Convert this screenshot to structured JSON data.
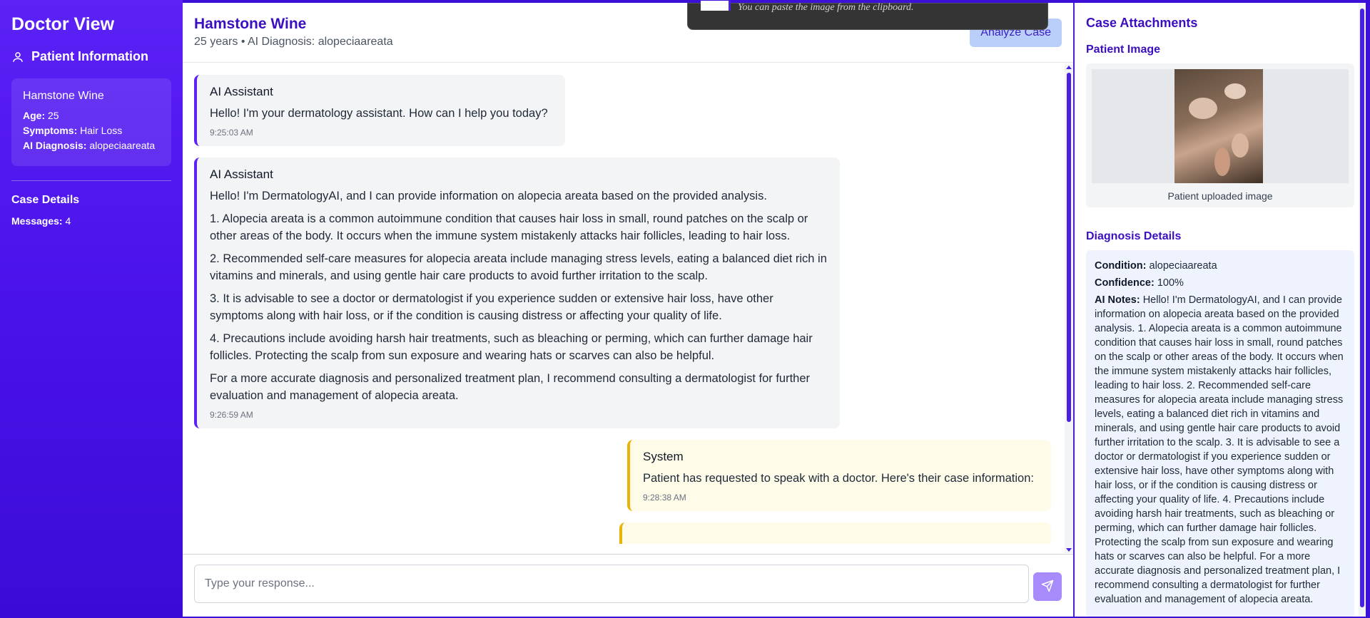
{
  "sidebar": {
    "title": "Doctor View",
    "section": "Patient Information",
    "patient": {
      "name": "Hamstone Wine",
      "age_label": "Age:",
      "age": "25",
      "symptoms_label": "Symptoms:",
      "symptoms": "Hair Loss",
      "diagnosis_label": "AI Diagnosis:",
      "diagnosis": "alopeciaareata"
    },
    "case_details": "Case Details",
    "messages_label": "Messages:",
    "messages_count": "4"
  },
  "header": {
    "name": "Hamstone Wine",
    "subtitle": "25 years • AI Diagnosis: alopeciaareata",
    "analyze_button": "Analyze Case"
  },
  "toast": {
    "text": "You can paste the image from the clipboard."
  },
  "messages": [
    {
      "sender": "AI Assistant",
      "paragraphs": [
        "Hello! I'm your dermatology assistant. How can I help you today?"
      ],
      "time": "9:25:03 AM"
    },
    {
      "sender": "AI Assistant",
      "paragraphs": [
        "Hello! I'm DermatologyAI, and I can provide information on alopecia areata based on the provided analysis.",
        "1. Alopecia areata is a common autoimmune condition that causes hair loss in small, round patches on the scalp or other areas of the body. It occurs when the immune system mistakenly attacks hair follicles, leading to hair loss.",
        "2. Recommended self-care measures for alopecia areata include managing stress levels, eating a balanced diet rich in vitamins and minerals, and using gentle hair care products to avoid further irritation to the scalp.",
        "3. It is advisable to see a doctor or dermatologist if you experience sudden or extensive hair loss, have other symptoms along with hair loss, or if the condition is causing distress or affecting your quality of life.",
        "4. Precautions include avoiding harsh hair treatments, such as bleaching or perming, which can further damage hair follicles. Protecting the scalp from sun exposure and wearing hats or scarves can also be helpful.",
        "For a more accurate diagnosis and personalized treatment plan, I recommend consulting a dermatologist for further evaluation and management of alopecia areata."
      ],
      "time": "9:26:59 AM"
    },
    {
      "sender": "System",
      "paragraphs": [
        "Patient has requested to speak with a doctor. Here's their case information:"
      ],
      "time": "9:28:38 AM"
    }
  ],
  "composer": {
    "placeholder": "Type your response..."
  },
  "right_panel": {
    "title": "Case Attachments",
    "image_heading": "Patient Image",
    "image_caption": "Patient uploaded image",
    "diagnosis_heading": "Diagnosis Details",
    "condition_label": "Condition:",
    "condition": "alopeciaareata",
    "confidence_label": "Confidence:",
    "confidence": "100%",
    "notes_label": "AI Notes:",
    "notes": "Hello! I'm DermatologyAI, and I can provide information on alopecia areata based on the provided analysis. 1. Alopecia areata is a common autoimmune condition that causes hair loss in small, round patches on the scalp or other areas of the body. It occurs when the immune system mistakenly attacks hair follicles, leading to hair loss. 2. Recommended self-care measures for alopecia areata include managing stress levels, eating a balanced diet rich in vitamins and minerals, and using gentle hair care products to avoid further irritation to the scalp. 3. It is advisable to see a doctor or dermatologist if you experience sudden or extensive hair loss, have other symptoms along with hair loss, or if the condition is causing distress or affecting your quality of life. 4. Precautions include avoiding harsh hair treatments, such as bleaching or perming, which can further damage hair follicles. Protecting the scalp from sun exposure and wearing hats or scarves can also be helpful. For a more accurate diagnosis and personalized treatment plan, I recommend consulting a dermatologist for further evaluation and management of alopecia areata."
  },
  "colors": {
    "brand": "#4b1fe0",
    "system_border": "#eab308"
  }
}
